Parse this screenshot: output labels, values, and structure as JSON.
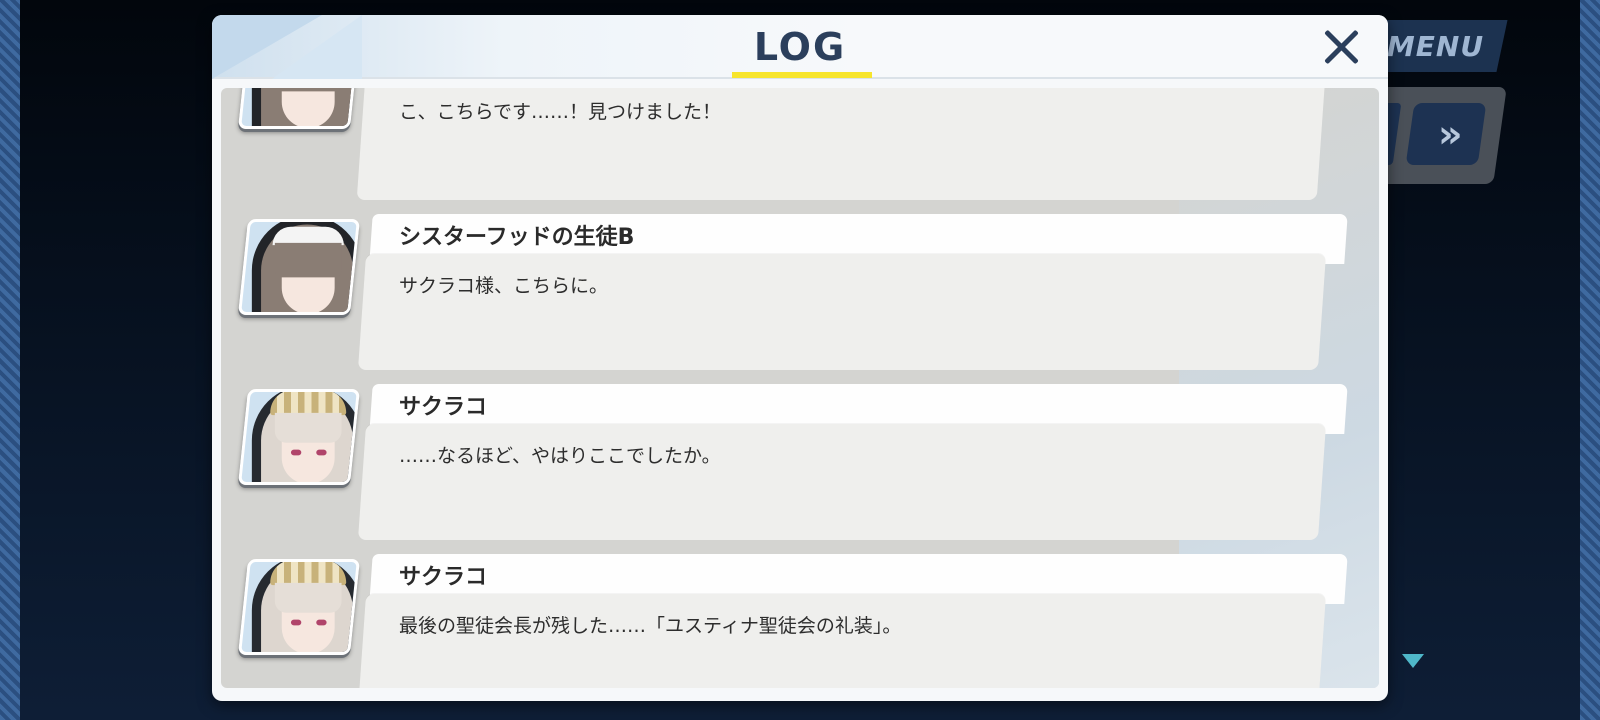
{
  "modal": {
    "title": "LOG",
    "close_icon": "close-x-icon"
  },
  "hud": {
    "menu_label": "MENU",
    "fast_forward_icon": "fast-forward-icon",
    "fast_forward_glyph": "»",
    "next_indicator_icon": "triangle-down-icon"
  },
  "log": {
    "entries": [
      {
        "speaker": "",
        "portrait": "nun-student-portrait",
        "text": "こ、こちらです……！見つけました！"
      },
      {
        "speaker": "シスターフッドの生徒B",
        "portrait": "nun-student-portrait",
        "text": "サクラコ様、こちらに。"
      },
      {
        "speaker": "サクラコ",
        "portrait": "sakurako-portrait",
        "text": "……なるほど、やはりここでしたか。"
      },
      {
        "speaker": "サクラコ",
        "portrait": "sakurako-portrait",
        "text": "最後の聖徒会長が残した……「ユスティナ聖徒会の礼装」。"
      }
    ]
  },
  "colors": {
    "title": "#2b3f5c",
    "title_underline": "#f7e52d",
    "log_background": "#d4d4d1",
    "message_box": "#efefed",
    "name_box": "#fefefe"
  }
}
